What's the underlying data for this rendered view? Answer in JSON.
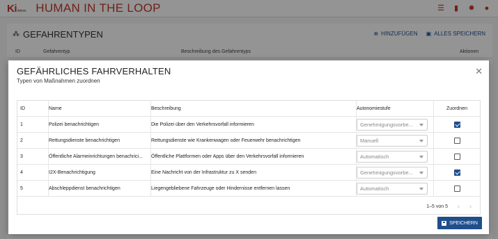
{
  "app": {
    "logo": "Ki",
    "logo_small": "fahren",
    "title": "HUMAN IN THE LOOP"
  },
  "topbar_icons": [
    "list-icon",
    "map-icon",
    "gear-icon",
    "info-icon"
  ],
  "background_panel": {
    "title": "GEFAHRENTYPEN",
    "add_label": "HINZUFÜGEN",
    "save_all_label": "ALLES SPEICHERN",
    "columns": [
      "ID",
      "Gefahrentyp",
      "Beschreibung des Gefahrentyps",
      "Aktionen"
    ]
  },
  "modal": {
    "title": "GEFÄHRLICHES FAHRVERHALTEN",
    "subtitle": "Typen von Maßnahmen zuordnen",
    "columns": {
      "id": "ID",
      "name": "Name",
      "description": "Beschreibung",
      "autonomy": "Autonomiestufe",
      "assign": "Zuordnen"
    },
    "rows": [
      {
        "id": "1",
        "name": "Polizei benachrichtigen",
        "description": "Die Polizei über den Verkehrsvorfall informieren",
        "autonomy": "Genehmigungsvorbe...",
        "assigned": true
      },
      {
        "id": "2",
        "name": "Rettungsdienste benachrichtigen",
        "description": "Rettungsdienste wie Krankenwagen oder Feuerwehr benachrichtigen",
        "autonomy": "Manuell",
        "assigned": false
      },
      {
        "id": "3",
        "name": "Öffentliche Alarmeinrichtungen benachrici...",
        "description": "Öffentliche Plattformen oder Apps über den Verkehrsvorfall informieren",
        "autonomy": "Automatisch",
        "assigned": false
      },
      {
        "id": "4",
        "name": "I2X-Benachrichtigung",
        "description": "Eine Nachricht von der Infrastruktur zu X senden",
        "autonomy": "Genehmigungsvorbe...",
        "assigned": true
      },
      {
        "id": "5",
        "name": "Abschleppdienst benachrichtigen",
        "description": "Liegengebliebene Fahrzeuge oder Hindernisse entfernen lassen",
        "autonomy": "Automatisch",
        "assigned": false
      }
    ],
    "pagination": "1–5 von 5",
    "save_label": "SPEICHERN"
  },
  "colors": {
    "brand_red": "#c0392b",
    "primary_blue": "#1f4e8c"
  }
}
